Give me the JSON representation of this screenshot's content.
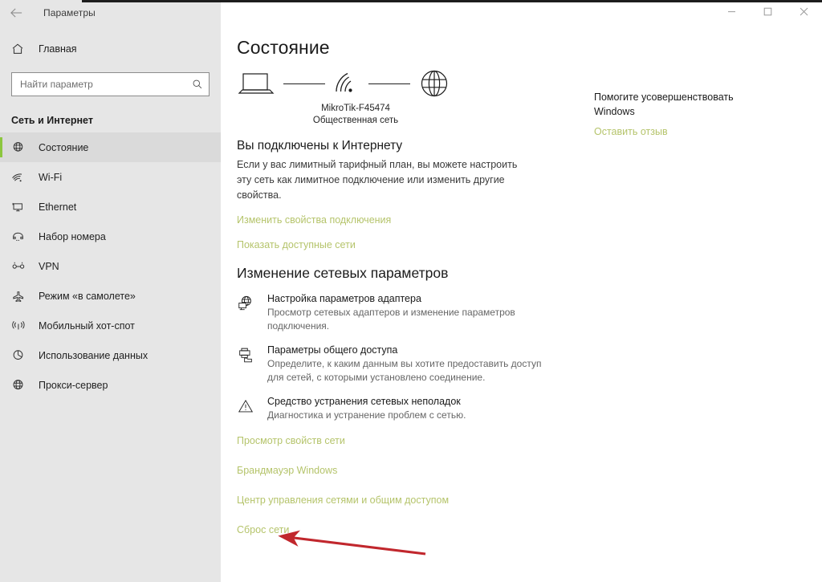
{
  "window": {
    "app_title": "Параметры",
    "back_icon": "back-arrow-icon",
    "controls": {
      "minimize": "minimize-icon",
      "maximize": "maximize-icon",
      "close": "close-icon"
    }
  },
  "sidebar": {
    "home": {
      "label": "Главная",
      "icon": "home-icon"
    },
    "search": {
      "placeholder": "Найти параметр",
      "value": "",
      "icon": "search-icon"
    },
    "category": "Сеть и Интернет",
    "items": [
      {
        "label": "Состояние",
        "icon": "globe-status-icon",
        "selected": true
      },
      {
        "label": "Wi-Fi",
        "icon": "wifi-icon",
        "selected": false
      },
      {
        "label": "Ethernet",
        "icon": "ethernet-icon",
        "selected": false
      },
      {
        "label": "Набор номера",
        "icon": "dialup-phone-icon",
        "selected": false
      },
      {
        "label": "VPN",
        "icon": "vpn-icon",
        "selected": false
      },
      {
        "label": "Режим «в самолете»",
        "icon": "airplane-icon",
        "selected": false
      },
      {
        "label": "Мобильный хот-спот",
        "icon": "hotspot-icon",
        "selected": false
      },
      {
        "label": "Использование данных",
        "icon": "data-usage-icon",
        "selected": false
      },
      {
        "label": "Прокси-сервер",
        "icon": "proxy-globe-icon",
        "selected": false
      }
    ]
  },
  "main": {
    "page_title": "Состояние",
    "diagram": {
      "device_icon": "laptop-icon",
      "network_icon": "wifi-signal-icon",
      "internet_icon": "globe-icon",
      "network_name": "MikroTik-F45474",
      "network_type": "Общественная сеть"
    },
    "status": {
      "heading": "Вы подключены к Интернету",
      "description": "Если у вас лимитный тарифный план, вы можете настроить эту сеть как лимитное подключение или изменить другие свойства.",
      "links": [
        "Изменить свойства подключения",
        "Показать доступные сети"
      ]
    },
    "change_settings": {
      "heading": "Изменение сетевых параметров",
      "items": [
        {
          "icon": "adapter-globe-icon",
          "title": "Настройка параметров адаптера",
          "description": "Просмотр сетевых адаптеров и изменение параметров подключения."
        },
        {
          "icon": "sharing-printer-icon",
          "title": "Параметры общего доступа",
          "description": "Определите, к каким данным вы хотите предоставить доступ для сетей, с которыми установлено соединение."
        },
        {
          "icon": "warning-triangle-icon",
          "title": "Средство устранения сетевых неполадок",
          "description": "Диагностика и устранение проблем с сетью."
        }
      ],
      "links": [
        "Просмотр свойств сети",
        "Брандмауэр Windows",
        "Центр управления сетями и общим доступом",
        "Сброс сети"
      ]
    }
  },
  "side_panel": {
    "heading": "Помогите усовершенствовать Windows",
    "link": "Оставить отзыв"
  },
  "annotation": {
    "type": "arrow",
    "color": "#c1272d",
    "points_to": "Сброс сети"
  },
  "colors": {
    "accent_green": "#8cc63e",
    "link": "#b5c46b",
    "sidebar_bg": "#e6e6e6",
    "annotation_red": "#c1272d"
  }
}
